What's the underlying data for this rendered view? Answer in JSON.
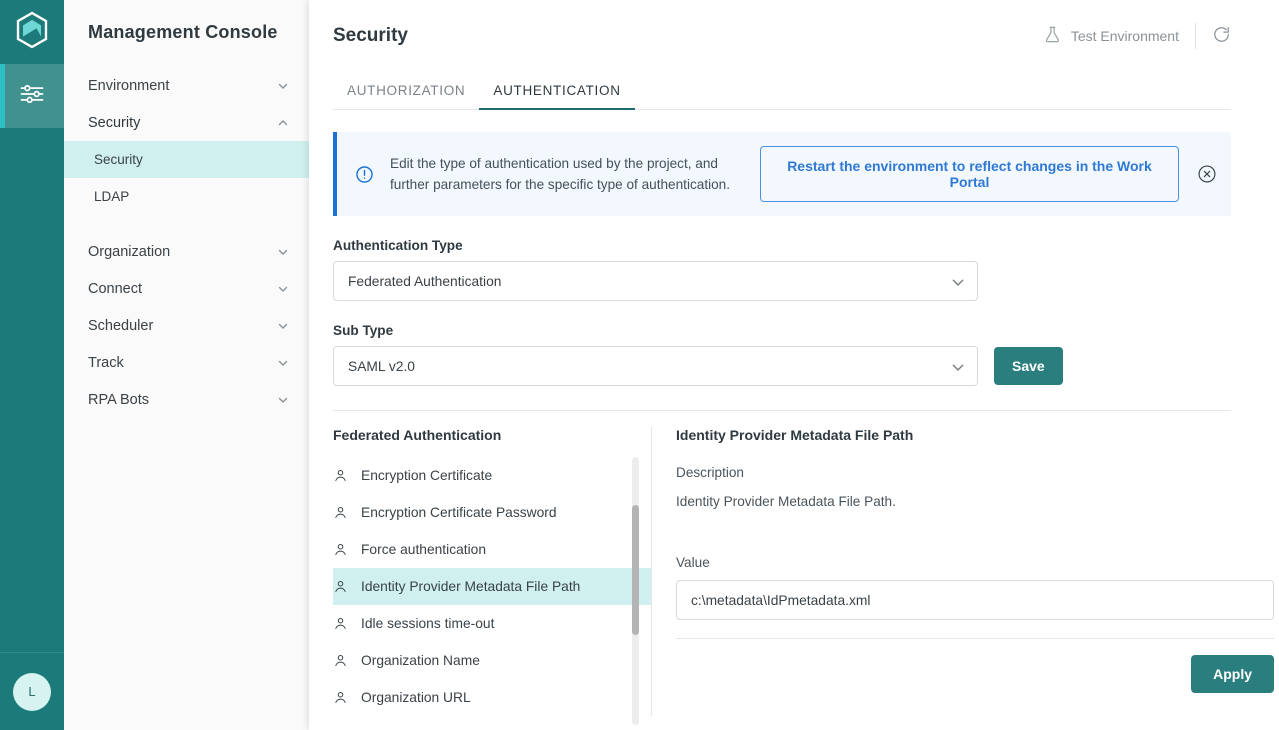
{
  "brand": {
    "logo_icon": "hexagon-logo-icon",
    "rail_items": [
      {
        "icon": "sliders-icon",
        "name": "settings-rail-item",
        "active": true
      }
    ],
    "avatar_initial": "L",
    "accent_teal": "#1C7A7A",
    "accent_cyan": "#2FBFC4",
    "highlight": "#CFF0EE"
  },
  "sidebar": {
    "title": "Management Console",
    "items": [
      {
        "label": "Environment",
        "type": "group",
        "expanded": false
      },
      {
        "label": "Security",
        "type": "group",
        "expanded": true
      },
      {
        "label": "Security",
        "type": "sub",
        "selected": true
      },
      {
        "label": "LDAP",
        "type": "sub",
        "selected": false
      },
      {
        "label": "Organization",
        "type": "group",
        "expanded": false
      },
      {
        "label": "Connect",
        "type": "group",
        "expanded": false
      },
      {
        "label": "Scheduler",
        "type": "group",
        "expanded": false
      },
      {
        "label": "Track",
        "type": "group",
        "expanded": false
      },
      {
        "label": "RPA Bots",
        "type": "group",
        "expanded": false
      }
    ]
  },
  "header": {
    "title": "Security",
    "environment_label": "Test Environment",
    "environment_icon": "flask-icon",
    "refresh_icon": "refresh-icon"
  },
  "tabs": [
    {
      "label": "AUTHORIZATION",
      "active": false
    },
    {
      "label": "AUTHENTICATION",
      "active": true
    }
  ],
  "banner": {
    "icon": "info-exclamation-icon",
    "text": "Edit the type of authentication used by the project, and further parameters for the specific type of authentication.",
    "button_label": "Restart the environment to reflect changes in the Work Portal",
    "close_icon": "close-circle-icon",
    "accent_color": "#1A73D4",
    "background": "#F2F8FD"
  },
  "form": {
    "auth_type_label": "Authentication Type",
    "auth_type_value": "Federated Authentication",
    "sub_type_label": "Sub Type",
    "sub_type_value": "SAML v2.0",
    "save_label": "Save"
  },
  "options_pane": {
    "heading": "Federated Authentication",
    "items": [
      {
        "label": "Encryption Certificate",
        "selected": false
      },
      {
        "label": "Encryption Certificate Password",
        "selected": false
      },
      {
        "label": "Force authentication",
        "selected": false
      },
      {
        "label": "Identity Provider Metadata File Path",
        "selected": true
      },
      {
        "label": "Idle sessions time-out",
        "selected": false
      },
      {
        "label": "Organization Name",
        "selected": false
      },
      {
        "label": "Organization URL",
        "selected": false
      }
    ]
  },
  "detail_pane": {
    "title": "Identity Provider Metadata File Path",
    "description_label": "Description",
    "description_text": "Identity Provider Metadata File Path.",
    "value_label": "Value",
    "value": "c:\\metadata\\IdPmetadata.xml",
    "apply_label": "Apply"
  }
}
